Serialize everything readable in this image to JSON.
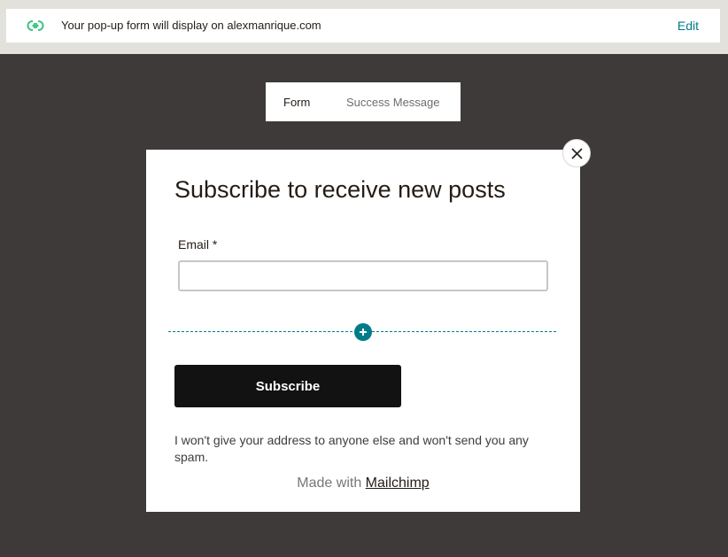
{
  "banner": {
    "prefix": "Your pop-up form will display on ",
    "domain": "alexmanrique.com",
    "edit_label": "Edit",
    "icon": "link-icon"
  },
  "tabs": [
    {
      "label": "Form",
      "active": true
    },
    {
      "label": "Success Message",
      "active": false
    }
  ],
  "popup": {
    "title": "Subscribe to receive new posts",
    "email_label": "Email *",
    "email_value": "",
    "add_icon": "plus-icon",
    "subscribe_label": "Subscribe",
    "disclaimer": "I won't give your address to anyone else and won't send you any spam.",
    "made_with_prefix": "Made with ",
    "made_with_brand": "Mailchimp",
    "close_icon": "close-icon"
  },
  "colors": {
    "accent": "#007c89",
    "background": "#3e3a39",
    "button": "#121212",
    "link_icon": "#3dc284"
  }
}
